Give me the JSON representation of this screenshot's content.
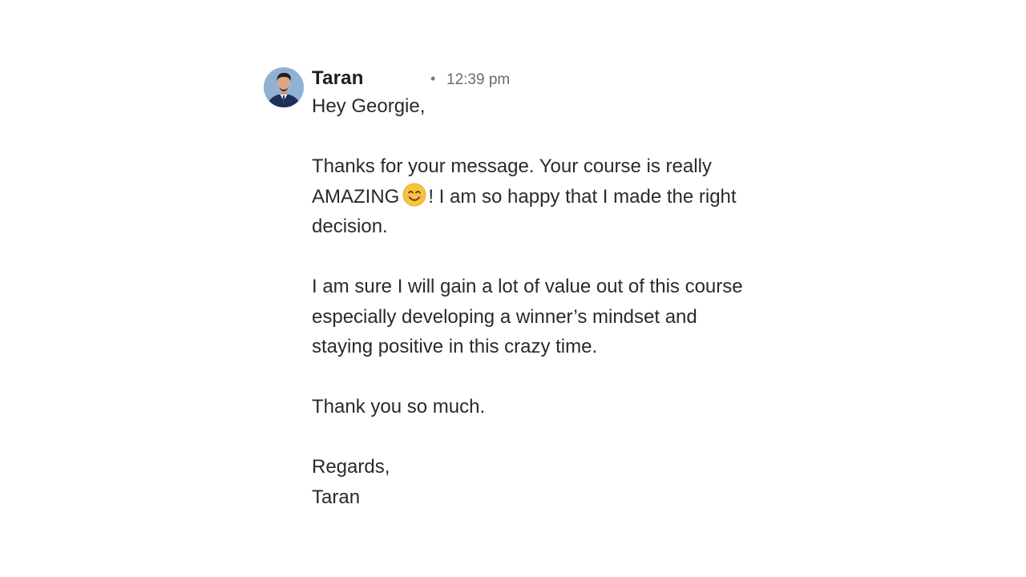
{
  "message": {
    "sender": "Taran",
    "timestamp": "12:39 pm",
    "separator": "•",
    "greeting": "Hey Georgie,",
    "paragraph1_part1": "Thanks for your message. Your course is really AMAZING",
    "paragraph1_part2": "! I am so happy that I made the right decision.",
    "paragraph2": "I am sure I will gain a lot of value out of this course especially developing a winner’s mindset and staying positive in this crazy time.",
    "paragraph3": "Thank you so much.",
    "closing": "Regards,",
    "signature": "Taran",
    "emoji_icon": "smiling-face-emoji"
  },
  "colors": {
    "avatar_bg": "#8fb2d4",
    "text": "#2a2a2a",
    "timestamp": "#6b6b6b",
    "emoji": "#f7c43a"
  }
}
